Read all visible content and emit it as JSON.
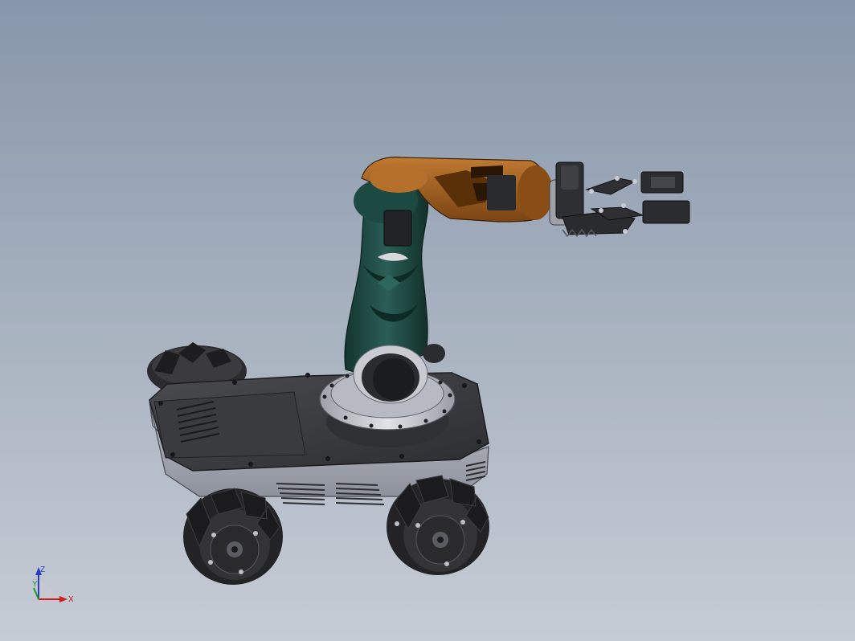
{
  "viewport": {
    "background_top": "#8796aa",
    "background_bottom": "#c6ccd5"
  },
  "model": {
    "parts": [
      "mobile-base",
      "mecanum-wheels",
      "turntable",
      "shoulder-link",
      "elbow-link",
      "gripper"
    ],
    "colors": {
      "chassis_top": "#3a3b3e",
      "chassis_side": "#a7aab4",
      "wheel": "#2b2b2d",
      "shoulder_link": "#1f4a44",
      "elbow_link": "#9a5a1e",
      "turntable": "#c8cad1",
      "gripper": "#333335"
    }
  },
  "triad": {
    "x_label": "X",
    "y_label": "Y",
    "z_label": "Z",
    "x_color": "#d21c1c",
    "y_color": "#1a9a2a",
    "z_color": "#2a3cc8"
  }
}
